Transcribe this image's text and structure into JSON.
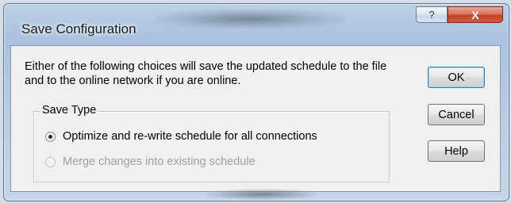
{
  "window": {
    "title": "Save Configuration",
    "help_glyph": "?",
    "close_glyph": "X",
    "accent_close": "#c5422a"
  },
  "description": "Either of the following choices will save the updated schedule to the file and to the online network if you are online.",
  "save_type": {
    "label": "Save Type",
    "options": [
      {
        "label": "Optimize and re-write schedule for all connections",
        "selected": true,
        "enabled": true
      },
      {
        "label": "Merge changes into existing schedule",
        "selected": false,
        "enabled": false
      }
    ]
  },
  "buttons": {
    "ok": "OK",
    "cancel": "Cancel",
    "help": "Help"
  }
}
